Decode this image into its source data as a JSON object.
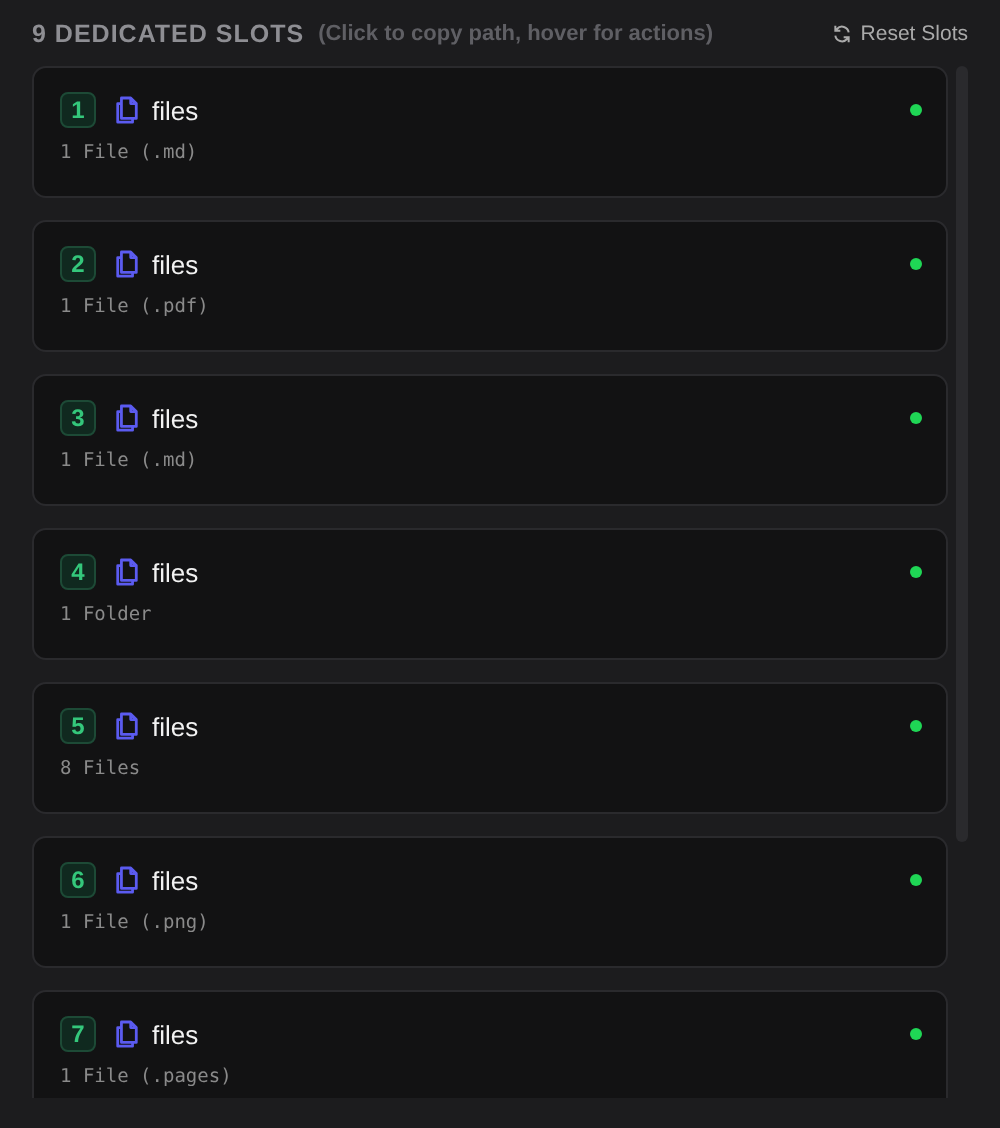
{
  "header": {
    "title": "9 DEDICATED SLOTS",
    "hint": "(Click to copy path, hover for actions)",
    "reset_button": "Reset Slots"
  },
  "slots": [
    {
      "number": "1",
      "name": "files",
      "detail": "1 File (.md)",
      "active": true
    },
    {
      "number": "2",
      "name": "files",
      "detail": "1 File (.pdf)",
      "active": true
    },
    {
      "number": "3",
      "name": "files",
      "detail": "1 File (.md)",
      "active": true
    },
    {
      "number": "4",
      "name": "files",
      "detail": "1 Folder",
      "active": true
    },
    {
      "number": "5",
      "name": "files",
      "detail": "8 Files",
      "active": true
    },
    {
      "number": "6",
      "name": "files",
      "detail": "1 File (.png)",
      "active": true
    },
    {
      "number": "7",
      "name": "files",
      "detail": "1 File (.pages)",
      "active": true
    }
  ]
}
